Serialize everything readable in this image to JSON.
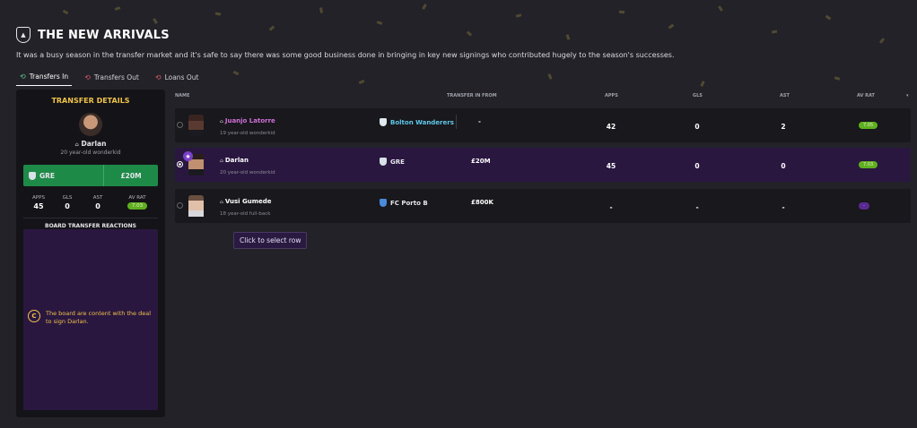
{
  "header": {
    "club_badge": "crest-icon",
    "title": "THE NEW ARRIVALS",
    "subtitle": "It was a busy season in the transfer market and it's safe to say there was some good business done in bringing in key new signings who contributed hugely to the season's successes."
  },
  "tabs": [
    {
      "label": "Transfers In",
      "icon": "arrow-in-icon",
      "active": true
    },
    {
      "label": "Transfers Out",
      "icon": "arrow-out-icon",
      "active": false
    },
    {
      "label": "Loans Out",
      "icon": "arrow-out-icon",
      "active": false
    }
  ],
  "details": {
    "title": "TRANSFER DETAILS",
    "player_name": "Darlan",
    "player_desc": "20 year-old wonderkid",
    "club": "GRE",
    "fee": "£20M",
    "stats_headers": [
      "APPS",
      "GLS",
      "AST",
      "AV RAT"
    ],
    "stats_values": [
      "45",
      "0",
      "0",
      "7.03"
    ],
    "board_title": "BOARD TRANSFER REACTIONS",
    "board_message": "The board are content with the deal to sign Darlan.",
    "board_badge": "C"
  },
  "table": {
    "headers": {
      "name": "NAME",
      "from": "TRANSFER IN FROM",
      "apps": "APPS",
      "gls": "GLS",
      "ast": "AST",
      "avrat": "AV RAT"
    },
    "rows": [
      {
        "name": "Juanjo Latorre",
        "desc": "19 year-old wonderkid",
        "from": "Bolton Wanderers",
        "fee": "-",
        "apps": "42",
        "gls": "0",
        "ast": "2",
        "avrat": "7.05",
        "selected": false
      },
      {
        "name": "Darlan",
        "desc": "20 year-old wonderkid",
        "from": "GRE",
        "fee": "£20M",
        "apps": "45",
        "gls": "0",
        "ast": "0",
        "avrat": "7.03",
        "selected": true
      },
      {
        "name": "Vusi Gumede",
        "desc": "18 year-old full-back",
        "from": "FC Porto B",
        "fee": "£800K",
        "apps": "-",
        "gls": "-",
        "ast": "-",
        "avrat": "-",
        "selected": false
      }
    ]
  },
  "tooltip": "Click to select row",
  "colors": {
    "accent_gold": "#f0c24a",
    "selected_row": "#2a1740",
    "fee_bar": "#1e8a48",
    "rating_green": "#5fb020"
  }
}
